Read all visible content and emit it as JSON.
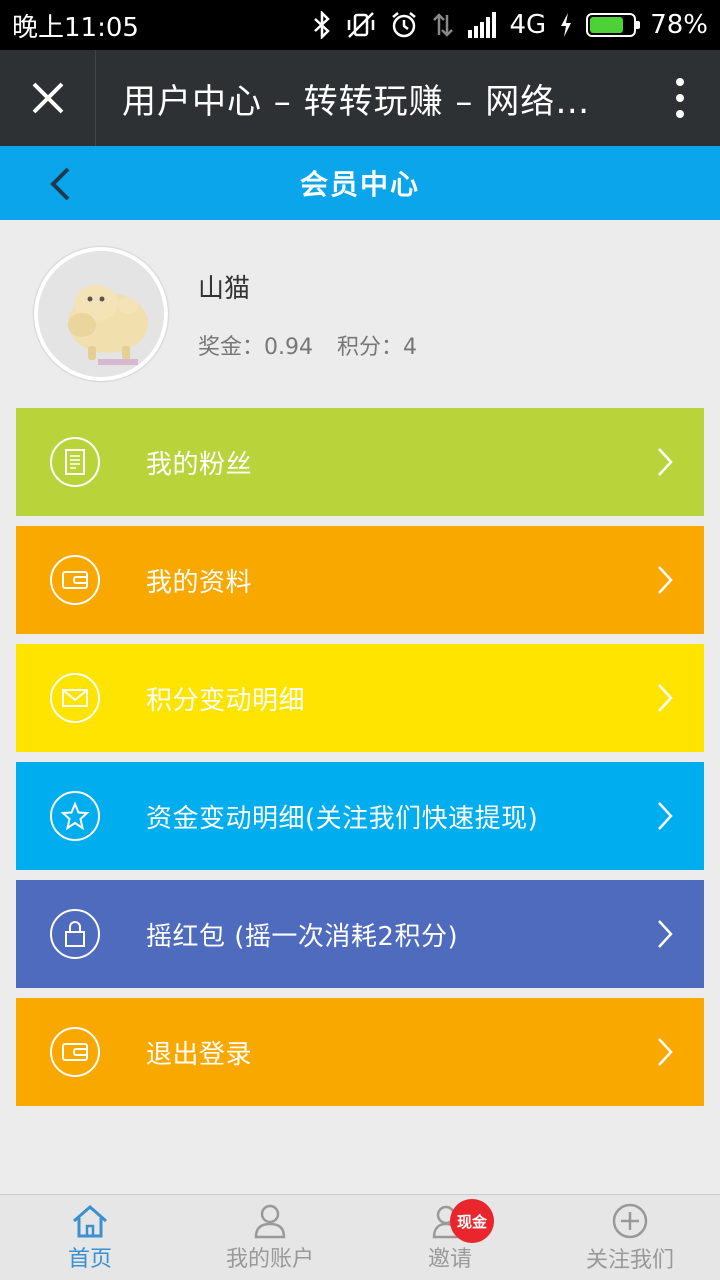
{
  "status_bar": {
    "time": "晚上11:05",
    "network": "4G",
    "battery": "78%",
    "battery_level": 0.78
  },
  "title_bar": {
    "title": "用户中心 – 转转玩赚 – 网络…"
  },
  "header": {
    "title": "会员中心"
  },
  "profile": {
    "name": "山猫",
    "bonus": "奖金：0.94",
    "points": "积分：4"
  },
  "menu": [
    {
      "label": "我的粉丝",
      "color": "#b9d43a",
      "icon": "document-icon"
    },
    {
      "label": "我的资料",
      "color": "#f9a800",
      "icon": "wallet-icon"
    },
    {
      "label": "积分变动明细",
      "color": "#ffe400",
      "icon": "mail-icon"
    },
    {
      "label": "资金变动明细(关注我们快速提现)",
      "color": "#00aeef",
      "icon": "star-icon"
    },
    {
      "label": "摇红包 (摇一次消耗2积分)",
      "color": "#4e6bbd",
      "icon": "lock-icon"
    },
    {
      "label": "退出登录",
      "color": "#f9a800",
      "icon": "wallet-icon"
    }
  ],
  "tabs": [
    {
      "label": "首页",
      "icon": "home-icon"
    },
    {
      "label": "我的账户",
      "icon": "user-icon"
    },
    {
      "label": "邀请",
      "icon": "invite-icon",
      "badge": "现金"
    },
    {
      "label": "关注我们",
      "icon": "plus-circle-icon"
    }
  ]
}
